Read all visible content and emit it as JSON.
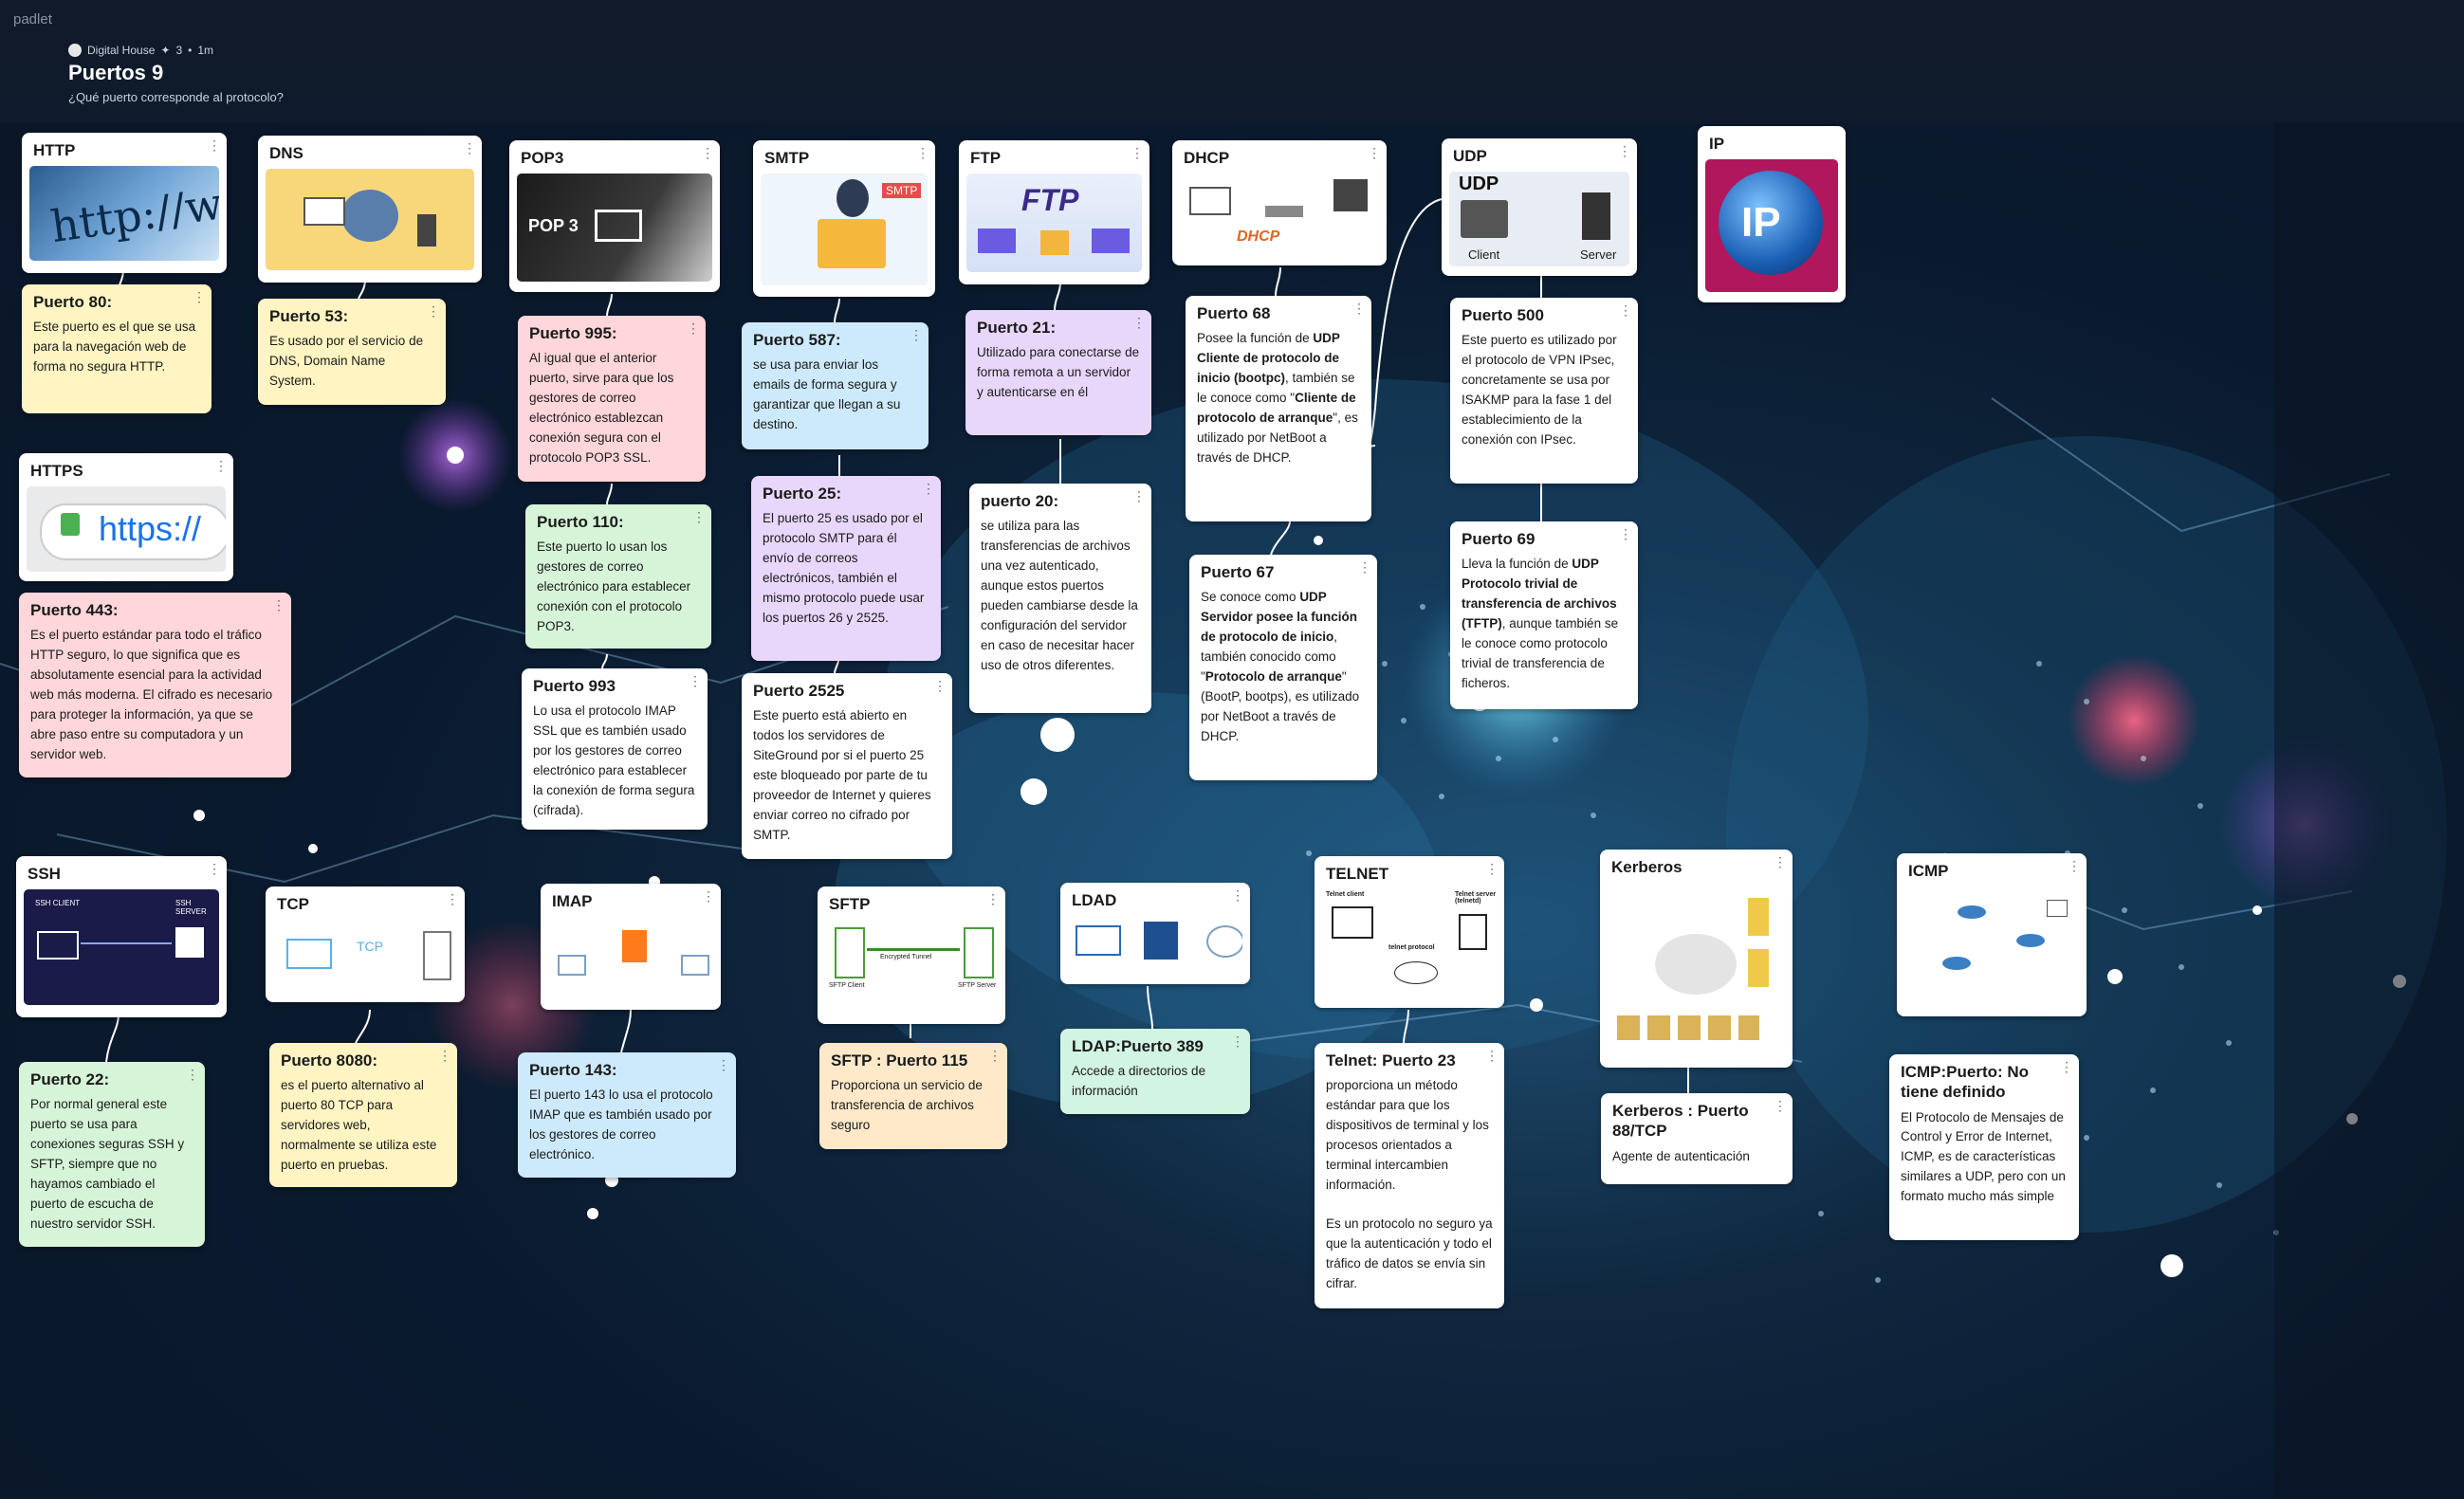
{
  "brand": "padlet",
  "board": {
    "author": "Digital House",
    "likes": "3",
    "age": "1m",
    "title": "Puertos 9",
    "subtitle": "¿Qué puerto corresponde al protocolo?"
  },
  "headers": {
    "http": "HTTP",
    "dns": "DNS",
    "pop3": "POP3",
    "smtp": "SMTP",
    "ftp": "FTP",
    "dhcp": "DHCP",
    "udp": "UDP",
    "ip": "IP",
    "https": "HTTPS",
    "ssh": "SSH",
    "tcp": "TCP",
    "imap": "IMAP",
    "sftp": "SFTP",
    "ldad": "LDAD",
    "telnet": "TELNET",
    "kerberos": "Kerberos",
    "icmp": "ICMP"
  },
  "image_text": {
    "http": "http://ww",
    "https": "https://",
    "pop3": "POP 3",
    "smtp": "SMTP",
    "ftp": "FTP",
    "udp": "UDP",
    "udp_client": "Client",
    "udp_server": "Server",
    "ip": "IP",
    "dhcp": "DHCP",
    "tcp": "TCP",
    "ssh_client": "SSH CLIENT",
    "ssh_server": "SSH SERVER",
    "sftp_client": "SFTP Client",
    "sftp_server": "SFTP Server",
    "sftp_tunnel": "Encrypted Tunnel",
    "telnet_client": "Telnet client",
    "telnet_server": "Telnet server (telnetd)",
    "telnet_protocol": "telnet protocol"
  },
  "notes": {
    "p80": {
      "title": "Puerto 80:",
      "body": "Este puerto es el que se usa para la navegación web de forma no segura HTTP."
    },
    "p53": {
      "title": "Puerto 53:",
      "body": "Es usado por el servicio de DNS, Domain Name System."
    },
    "p995": {
      "title": "Puerto 995:",
      "body": "Al igual que el anterior puerto, sirve para que los gestores de correo electrónico establezcan conexión segura con el protocolo POP3 SSL."
    },
    "p110": {
      "title": "Puerto 110:",
      "body": "Este puerto lo usan los gestores de correo electrónico para establecer conexión con el protocolo POP3."
    },
    "p993": {
      "title": "Puerto 993",
      "body": "Lo usa el protocolo IMAP SSL que es también usado por los gestores de correo electrónico para establecer la conexión de forma segura (cifrada)."
    },
    "p587": {
      "title": "Puerto 587:",
      "body": "se usa para enviar los emails de forma segura y garantizar que llegan a su destino."
    },
    "p25": {
      "title": "Puerto 25:",
      "body": "El puerto 25 es usado por el protocolo SMTP para él envío de correos electrónicos, también el mismo protocolo puede usar los puertos 26 y 2525."
    },
    "p2525": {
      "title": "Puerto 2525",
      "body": "Este puerto está abierto en todos los servidores de SiteGround por si el puerto 25 este bloqueado por parte de tu proveedor de Internet y quieres enviar correo no cifrado por SMTP."
    },
    "p21": {
      "title": "Puerto 21:",
      "body": "Utilizado para conectarse de forma remota a un servidor y autenticarse en él"
    },
    "p20": {
      "title": "puerto 20:",
      "body": "se utiliza para las transferencias de archivos una vez autenticado, aunque estos puertos pueden cambiarse desde la configuración del servidor en caso de necesitar hacer uso de otros diferentes."
    },
    "p68": {
      "title": "Puerto 68",
      "body_a": "Posee la función de ",
      "body_b": "UDP Cliente de protocolo de inicio (bootpc)",
      "body_c": ", también se le conoce como \"",
      "body_d": "Cliente de protocolo de arranque",
      "body_e": "\", es utilizado por NetBoot a través de DHCP."
    },
    "p67": {
      "title": "Puerto 67",
      "body_a": "Se conoce como ",
      "body_b": "UDP Servidor posee la función de protocolo de inicio",
      "body_c": ", también conocido como \"",
      "body_d": "Protocolo de arranque",
      "body_e": "\" (BootP, bootps), es utilizado por NetBoot a través de DHCP."
    },
    "p500": {
      "title": "Puerto 500",
      "body": "Este puerto es utilizado por el protocolo de VPN IPsec, concretamente se usa por ISAKMP para la fase 1 del establecimiento de la conexión con IPsec."
    },
    "p69": {
      "title": "Puerto 69",
      "body_a": "Lleva la función de ",
      "body_b": "UDP Protocolo trivial de transferencia de archivos (TFTP)",
      "body_c": ", aunque también se le conoce como protocolo trivial de transferencia de ficheros."
    },
    "p443": {
      "title": "Puerto 443:",
      "body": "Es el puerto estándar para todo el tráfico HTTP seguro, lo que significa que es absolutamente esencial para la actividad web más moderna. El cifrado es necesario para proteger la información, ya que se abre paso entre su computadora y un servidor web."
    },
    "p22": {
      "title": "Puerto 22:",
      "body": "Por normal general este puerto se usa para conexiones seguras SSH y SFTP, siempre que no hayamos cambiado el puerto de escucha de nuestro servidor SSH."
    },
    "p8080": {
      "title": "Puerto 8080:",
      "body": "es el puerto alternativo al puerto 80 TCP para servidores web, normalmente se utiliza este puerto en pruebas."
    },
    "p143": {
      "title": "Puerto 143:",
      "body": "El puerto 143 lo usa el protocolo IMAP que es también usado por los gestores de correo electrónico."
    },
    "p115": {
      "title": "SFTP : Puerto 115",
      "body": "Proporciona un servicio de transferencia de archivos seguro"
    },
    "p389": {
      "title": "LDAP:Puerto 389",
      "body": "Accede a directorios de información"
    },
    "p23": {
      "title": "Telnet: Puerto 23",
      "body": "proporciona un método estándar para que los dispositivos de terminal y los procesos orientados a terminal intercambien información.",
      "body2": "Es un protocolo no seguro ya que la autenticación y todo el tráfico de datos se envía sin cifrar."
    },
    "p88": {
      "title": "Kerberos : Puerto 88/TCP",
      "body": "Agente de autenticación"
    },
    "icmp": {
      "title": "ICMP:Puerto: No tiene definido",
      "body": "El Protocolo de Mensajes de Control y Error de Internet, ICMP, es de características similares a UDP, pero con un formato mucho más simple"
    }
  },
  "menu_glyph": "⋮"
}
